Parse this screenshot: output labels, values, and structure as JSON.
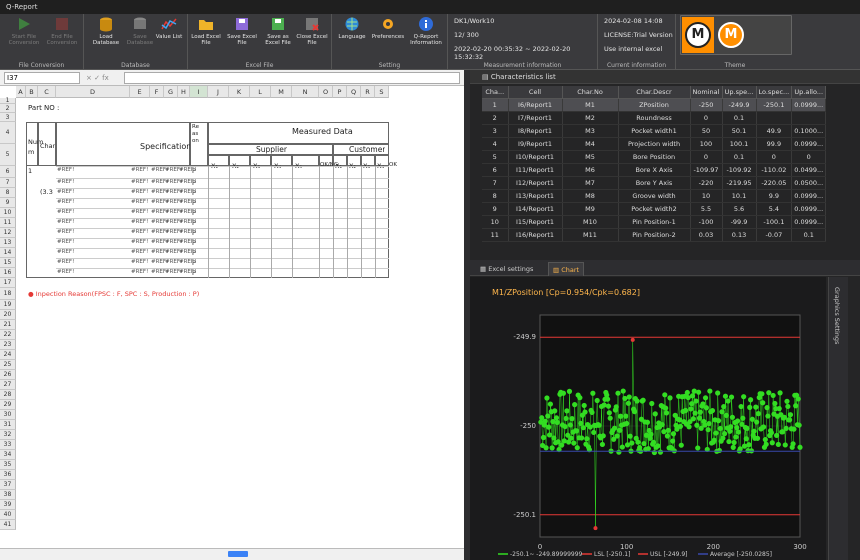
{
  "app": {
    "title": "Q-Report"
  },
  "ribbon": {
    "groups": {
      "file_conversion": "File Conversion",
      "database": "Database",
      "excel_file": "Excel File",
      "setting": "Setting",
      "measurement_info": "Measurement information",
      "current_info": "Current information",
      "theme": "Theme"
    },
    "buttons": {
      "start_file_conversion": "Start File Conversion",
      "end_file_conversion": "End File Conversion",
      "load_database": "Load Database",
      "save_database": "Save Database",
      "value_list": "Value List",
      "load_excel_file": "Load Excel File",
      "save_excel_file": "Save Excel File",
      "save_as_excel_file": "Save as Excel File",
      "close_excel_file": "Close Excel File",
      "language": "Language",
      "preferences": "Preferences",
      "q_report_information": "Q-Report Information"
    },
    "measurement": {
      "work": "DK1/Work10",
      "count": "12/ 300",
      "range": "2022-02-20 00:35:32 ~ 2022-02-20 15:32:32"
    },
    "current": {
      "date": "2024-02-08 14:08",
      "license": "LICENSE:Trial Version",
      "excel": "Use internal excel"
    },
    "theme_letter": "M"
  },
  "excel": {
    "namebox": "I37",
    "fx": "×  ✓  fx",
    "columns": [
      "A",
      "B",
      "C",
      "D",
      "E",
      "F",
      "G",
      "H",
      "I",
      "J",
      "K",
      "L",
      "M",
      "N",
      "O",
      "P",
      "Q",
      "R",
      "S"
    ],
    "part_no": "Part NO :",
    "num": "Num",
    "num_m": "m",
    "char": "Char",
    "specification": "Specification",
    "reason": "Reason",
    "measured_data": "Measured Data",
    "supplier": "Supplier",
    "customer": "Customer",
    "x_labels": [
      "X₁",
      "X₂",
      "X₃",
      "X₄",
      "X₅"
    ],
    "okng": "OK/NG",
    "ok_short": "OK",
    "num1": "1",
    "char_sub": "(3.3",
    "ref": "#REF!",
    "p": "P",
    "inspection_note": "●  Inpection Reason(FPSC : F, SPC : S, Production : P)",
    "rows": [
      "1",
      "2",
      "3",
      "4",
      "5",
      "6",
      "7",
      "8",
      "9",
      "10",
      "11",
      "12",
      "13",
      "14",
      "15",
      "16",
      "17",
      "18",
      "19",
      "20",
      "21",
      "22",
      "23",
      "24",
      "25",
      "26",
      "27",
      "28",
      "29",
      "30",
      "31",
      "32",
      "33",
      "34",
      "35",
      "36",
      "37",
      "38",
      "39",
      "40",
      "41"
    ]
  },
  "char_list": {
    "title": "Characteristics list",
    "headers": [
      "Cha...",
      "Cell",
      "Char.No",
      "Char.Descr",
      "Nominal",
      "Up.spe...",
      "Lo.spec...",
      "Up.allo..."
    ],
    "rows": [
      [
        "1",
        "I6/Report1",
        "M1",
        "ZPosition",
        "-250",
        "-249.9",
        "-250.1",
        "0.0999..."
      ],
      [
        "2",
        "I7/Report1",
        "M2",
        "Roundness",
        "0",
        "0.1",
        "",
        ""
      ],
      [
        "3",
        "I8/Report1",
        "M3",
        "Pocket width1",
        "50",
        "50.1",
        "49.9",
        "0.1000..."
      ],
      [
        "4",
        "I9/Report1",
        "M4",
        "Projection width",
        "100",
        "100.1",
        "99.9",
        "0.0999..."
      ],
      [
        "5",
        "I10/Report1",
        "M5",
        "Bore Position",
        "0",
        "0.1",
        "0",
        "0"
      ],
      [
        "6",
        "I11/Report1",
        "M6",
        "Bore X Axis",
        "-109.97",
        "-109.92",
        "-110.02",
        "0.0499..."
      ],
      [
        "7",
        "I12/Report1",
        "M7",
        "Bore Y Axis",
        "-220",
        "-219.95",
        "-220.05",
        "0.0500..."
      ],
      [
        "8",
        "I13/Report1",
        "M8",
        "Groove width",
        "10",
        "10.1",
        "9.9",
        "0.0999..."
      ],
      [
        "9",
        "I14/Report1",
        "M9",
        "Pocket width2",
        "5.5",
        "5.6",
        "5.4",
        "0.0999..."
      ],
      [
        "10",
        "I15/Report1",
        "M10",
        "Pin Position-1",
        "-100",
        "-99.9",
        "-100.1",
        "0.0999..."
      ],
      [
        "11",
        "I16/Report1",
        "M11",
        "Pin Position-2",
        "0.03",
        "0.13",
        "-0.07",
        "0.1"
      ]
    ]
  },
  "tabs": {
    "excel_settings": "Excel settings",
    "chart": "Chart"
  },
  "graphics_settings": "Graphics Settings",
  "colors": {
    "accent": "#ffb74d",
    "series": "#33dd22",
    "limit": "#e53935",
    "average": "#3949ab"
  },
  "chart_data": {
    "type": "line",
    "title": "M1/ZPosition [Cp=0.954/Cpk=0.682]",
    "xlim": [
      0,
      300
    ],
    "ylim": [
      -250.125,
      -249.875
    ],
    "x_ticks": [
      0,
      100,
      200,
      300
    ],
    "y_ticks": [
      -249.9,
      -250,
      -250.1
    ],
    "usl": -249.9,
    "lsl": -250.1,
    "average": -250.0285,
    "point_count": 300,
    "max_point": {
      "x": 107,
      "y": -249.903
    },
    "min_point": {
      "x": 64,
      "y": -250.115
    },
    "series": [
      {
        "name": "-250.1~ -249.89999999",
        "values_range": [
          -250.03,
          -249.96
        ]
      }
    ],
    "legend": [
      "-250.1~ -249.89999999",
      "LSL [-250.1]",
      "USL [-249.9]",
      "Average [-250.0285]"
    ]
  }
}
